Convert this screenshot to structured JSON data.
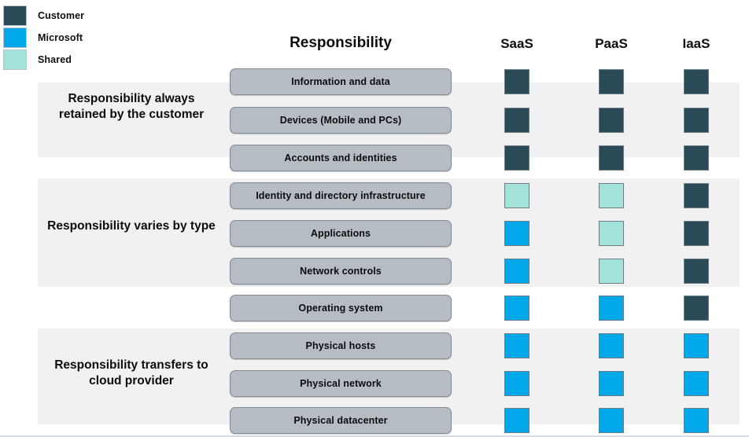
{
  "legend": {
    "items": [
      {
        "label": "Customer",
        "color": "#2a4a57"
      },
      {
        "label": "Microsoft",
        "color": "#00a8ea"
      },
      {
        "label": "Shared",
        "color": "#a4e3da"
      }
    ]
  },
  "headers": {
    "responsibility": "Responsibility",
    "saas": "SaaS",
    "paas": "PaaS",
    "iaas": "IaaS"
  },
  "groups": [
    {
      "label": "Responsibility always retained by the customer"
    },
    {
      "label": "Responsibility varies by type"
    },
    {
      "label": "Responsibility transfers to cloud provider"
    }
  ],
  "colors": {
    "customer": "#2a4a57",
    "microsoft": "#00a8ea",
    "shared": "#a4e3da",
    "band": "#f1f1f1",
    "pill_fill": "#b6bcc4",
    "pill_border": "#808a96"
  },
  "rows": [
    {
      "label": "Information and data",
      "group": 0,
      "saas": "customer",
      "paas": "customer",
      "iaas": "customer"
    },
    {
      "label": "Devices (Mobile and PCs)",
      "group": 0,
      "saas": "customer",
      "paas": "customer",
      "iaas": "customer"
    },
    {
      "label": "Accounts and identities",
      "group": 0,
      "saas": "customer",
      "paas": "customer",
      "iaas": "customer"
    },
    {
      "label": "Identity and directory infrastructure",
      "group": 1,
      "saas": "shared",
      "paas": "shared",
      "iaas": "customer"
    },
    {
      "label": "Applications",
      "group": 1,
      "saas": "microsoft",
      "paas": "shared",
      "iaas": "customer"
    },
    {
      "label": "Network controls",
      "group": 1,
      "saas": "microsoft",
      "paas": "shared",
      "iaas": "customer"
    },
    {
      "label": "Operating system",
      "group": 1,
      "saas": "microsoft",
      "paas": "microsoft",
      "iaas": "customer"
    },
    {
      "label": "Physical hosts",
      "group": 2,
      "saas": "microsoft",
      "paas": "microsoft",
      "iaas": "microsoft"
    },
    {
      "label": "Physical network",
      "group": 2,
      "saas": "microsoft",
      "paas": "microsoft",
      "iaas": "microsoft"
    },
    {
      "label": "Physical datacenter",
      "group": 2,
      "saas": "microsoft",
      "paas": "microsoft",
      "iaas": "microsoft"
    }
  ],
  "layout": {
    "row_tops": [
      87,
      136,
      184,
      232,
      280,
      328,
      375,
      423,
      471,
      518
    ]
  }
}
